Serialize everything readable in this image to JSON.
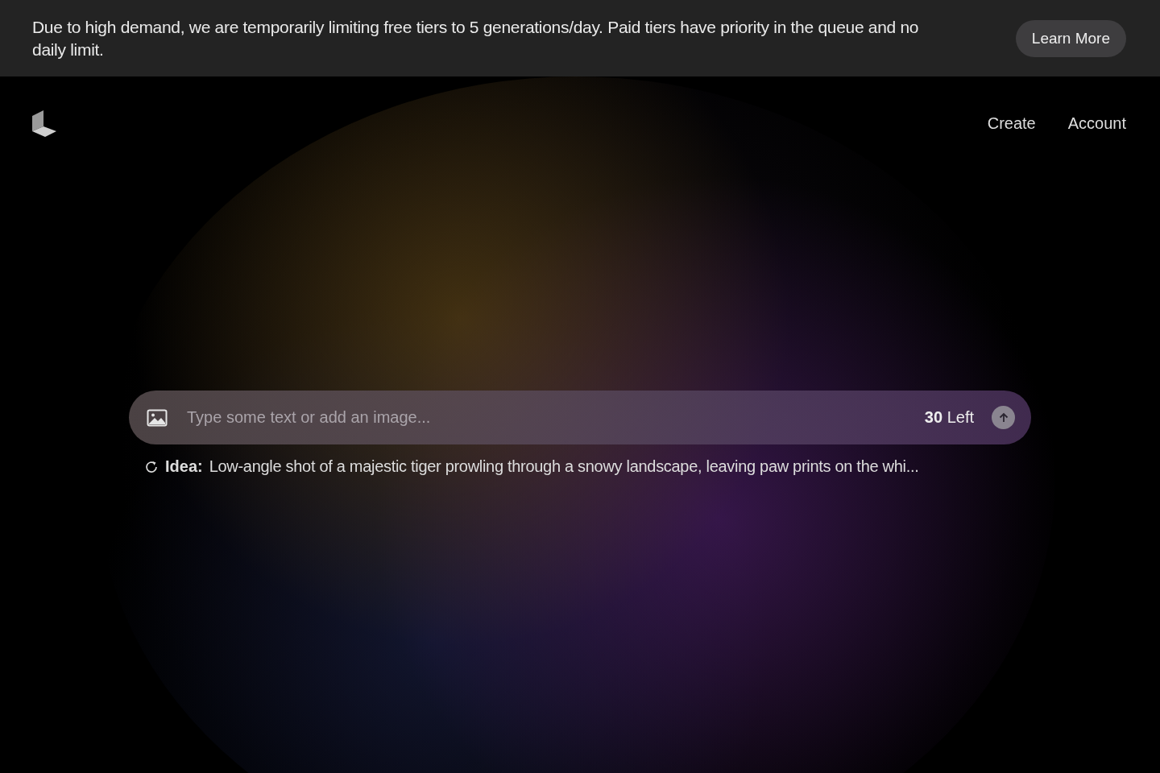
{
  "banner": {
    "message": "Due to high demand, we are temporarily limiting free tiers to 5 generations/day. Paid tiers have priority in the queue and no daily limit.",
    "button": "Learn More"
  },
  "nav": [
    {
      "label": "Create"
    },
    {
      "label": "Account"
    }
  ],
  "prompt": {
    "placeholder": "Type some text or add an image...",
    "remaining": "**30** Left"
  },
  "idea": {
    "label": "Idea:",
    "text": "Low-angle shot of a majestic tiger prowling through a snowy landscape, leaving paw prints on the whi..."
  }
}
